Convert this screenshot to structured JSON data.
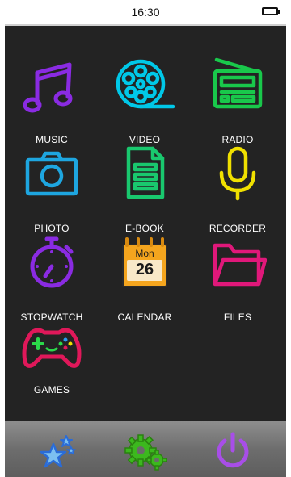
{
  "status_bar": {
    "time": "16:30"
  },
  "apps": [
    {
      "label": "MUSIC",
      "icon": "music-note-icon",
      "color": "#8a2be2"
    },
    {
      "label": "VIDEO",
      "icon": "film-reel-icon",
      "color": "#00c8e8"
    },
    {
      "label": "RADIO",
      "icon": "radio-icon",
      "color": "#19c84b"
    },
    {
      "label": "PHOTO",
      "icon": "camera-icon",
      "color": "#1ea6e0"
    },
    {
      "label": "E-BOOK",
      "icon": "document-icon",
      "color": "#19c86e"
    },
    {
      "label": "RECORDER",
      "icon": "microphone-icon",
      "color": "#f0e000"
    },
    {
      "label": "STOPWATCH",
      "icon": "stopwatch-icon",
      "color": "#8a2be2"
    },
    {
      "label": "CALENDAR",
      "icon": "calendar-icon",
      "color": "#f4a51e",
      "calendar": {
        "day_name": "Mon",
        "day_number": "26"
      }
    },
    {
      "label": "FILES",
      "icon": "folder-icon",
      "color": "#e0187a"
    },
    {
      "label": "GAMES",
      "icon": "gamepad-icon",
      "color": "#e0185a"
    }
  ],
  "dock": [
    {
      "icon": "stars-icon",
      "color": "#2a6cd8"
    },
    {
      "icon": "gears-icon",
      "color": "#3cb81e"
    },
    {
      "icon": "power-icon",
      "color": "#a84ee8"
    }
  ]
}
